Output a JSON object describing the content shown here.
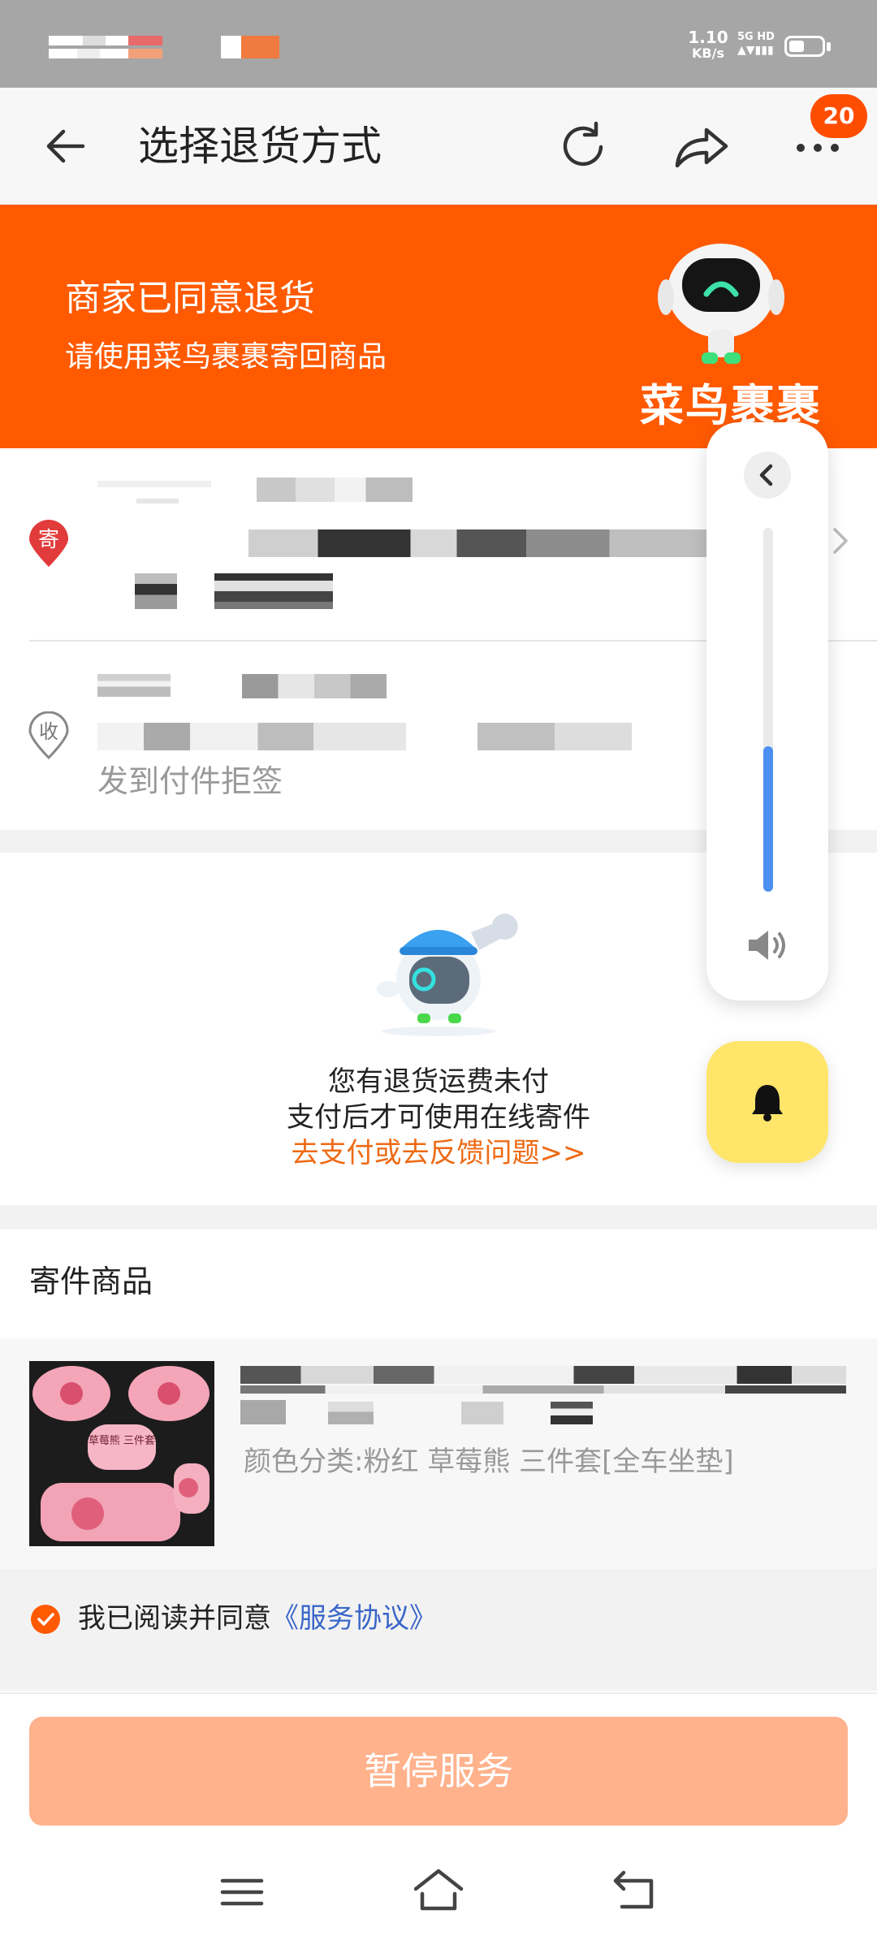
{
  "status_bar": {
    "net_speed": "1.10",
    "net_unit": "KB/s",
    "network": "5G HD"
  },
  "header": {
    "title": "选择退货方式",
    "badge_count": "20"
  },
  "banner": {
    "title": "商家已同意退货",
    "subtitle": "请使用菜鸟裹裹寄回商品",
    "logo_text": "菜鸟裹裹"
  },
  "address": {
    "sender_tag": "寄",
    "receiver_tag": "收",
    "note": "发到付件拒签"
  },
  "payment_notice": {
    "line1": "您有退货运费未付",
    "line2": "支付后才可使用在线寄件",
    "link": "去支付或去反馈问题>>"
  },
  "goods": {
    "section_title": "寄件商品",
    "spec": "颜色分类:粉红 草莓熊 三件套[全车坐垫]",
    "thumb_label": "草莓熊 三件套"
  },
  "agreement": {
    "text": "我已阅读并同意",
    "link": "《服务协议》"
  },
  "actions": {
    "pause_label": "暂停服务"
  },
  "volume": {
    "level": 0.4
  },
  "colors": {
    "brand_orange": "#ff5a00",
    "link_blue": "#3a66c8",
    "volume_blue": "#4b8ff0",
    "button_disabled": "#ffb28c"
  }
}
